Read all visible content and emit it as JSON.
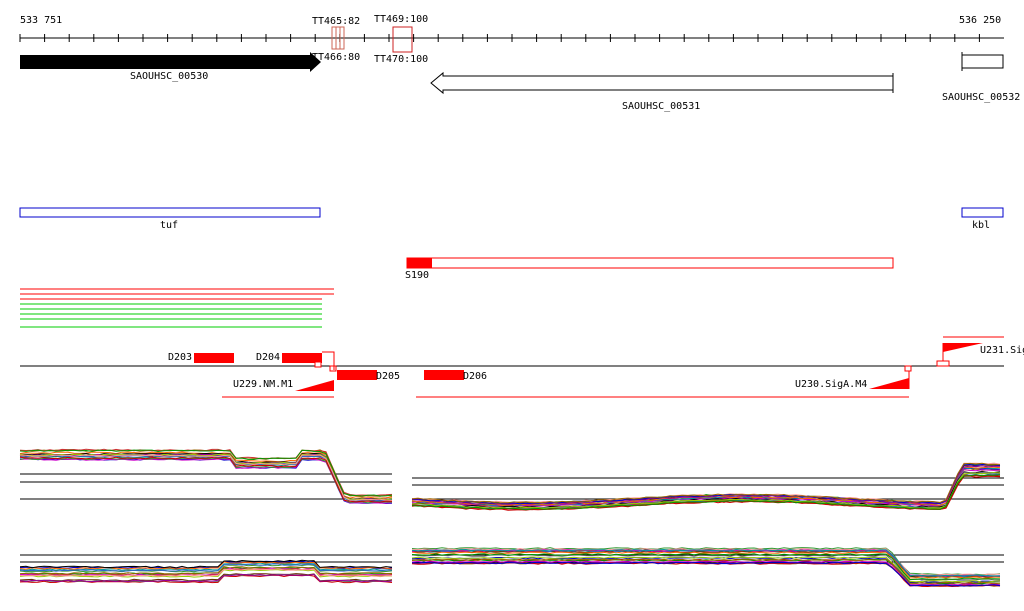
{
  "coordinates": {
    "start": "533 751",
    "end": "536 250"
  },
  "terminators": [
    {
      "label": "TT465:82"
    },
    {
      "label": "TT466:80"
    },
    {
      "label": "TT469:100"
    },
    {
      "label": "TT470:100"
    }
  ],
  "genes": [
    {
      "label": "SAOUHSC_00530",
      "strand": "+"
    },
    {
      "label": "SAOUHSC_00531",
      "strand": "-"
    },
    {
      "label": "SAOUHSC_00532",
      "strand": "?"
    }
  ],
  "gene_names": [
    {
      "label": "tuf"
    },
    {
      "label": "kbl"
    }
  ],
  "srna": {
    "label": "S190"
  },
  "downregulated": [
    {
      "label": "D203"
    },
    {
      "label": "D204"
    },
    {
      "label": "D205"
    },
    {
      "label": "D206"
    }
  ],
  "upregulated": [
    {
      "label": "U229.NM.M1"
    },
    {
      "label": "U230.SigA.M4"
    },
    {
      "label": "U231.Sig"
    }
  ],
  "colors": {
    "gene_fill": "#000000",
    "gene_name_box": "#0000cc",
    "srna": "#ff0000",
    "terminator": "#cc6655",
    "track_red": "#ff0000",
    "track_green": "#00cc00"
  }
}
